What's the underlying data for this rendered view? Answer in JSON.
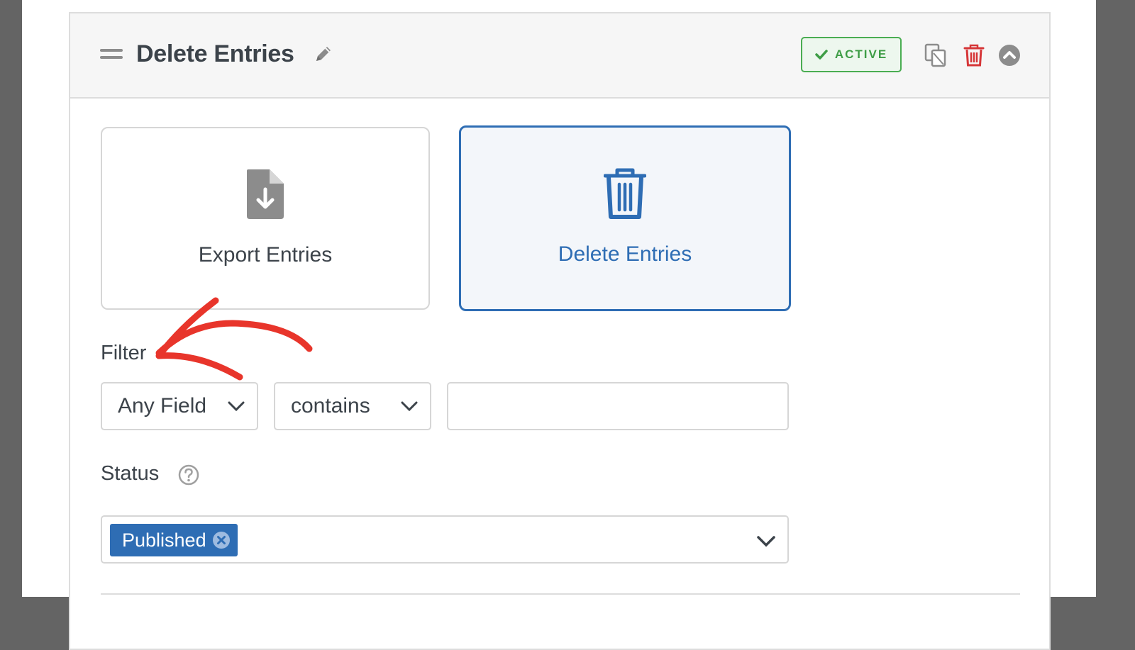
{
  "panel": {
    "title": "Delete Entries",
    "status_badge": "ACTIVE",
    "icons": {
      "drag": "drag-handle-icon",
      "edit": "pencil-icon",
      "duplicate": "duplicate-icon",
      "delete": "trash-icon",
      "collapse": "chevron-up-circle-icon"
    }
  },
  "action_types": [
    {
      "label": "Export Entries",
      "icon": "file-download-icon",
      "selected": false
    },
    {
      "label": "Delete Entries",
      "icon": "trash-icon",
      "selected": true
    }
  ],
  "filter": {
    "label": "Filter",
    "field_select": "Any Field",
    "operator_select": "contains",
    "value": ""
  },
  "status": {
    "label": "Status",
    "selected_tags": [
      "Published"
    ]
  },
  "colors": {
    "accent": "#2e6db4",
    "active_green": "#3e9d46",
    "danger": "#d63638",
    "annotation": "#e8352b"
  }
}
